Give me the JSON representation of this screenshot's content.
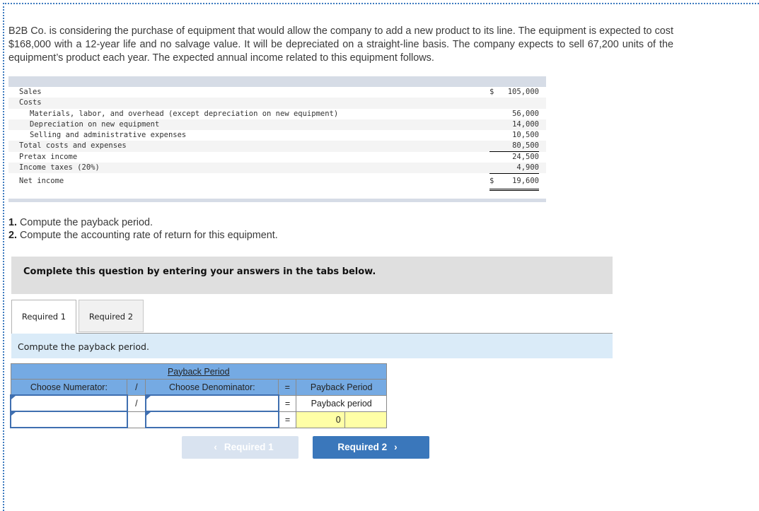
{
  "intro": "B2B Co. is considering the purchase of equipment that would allow the company to add a new product to its line. The equipment is expected to cost $168,000 with a 12-year life and no salvage value. It will be depreciated on a straight-line basis. The company expects to sell 67,200 units of the equipment’s product each year. The expected annual income related to this equipment follows.",
  "income_statement": {
    "rows": [
      {
        "label": "Sales",
        "currency": "$",
        "value": "105,000"
      },
      {
        "label": "Costs",
        "currency": "",
        "value": ""
      },
      {
        "label": "Materials, labor, and overhead (except depreciation on new equipment)",
        "currency": "",
        "value": "56,000"
      },
      {
        "label": "Depreciation on new equipment",
        "currency": "",
        "value": "14,000"
      },
      {
        "label": "Selling and administrative expenses",
        "currency": "",
        "value": "10,500"
      },
      {
        "label": "Total costs and expenses",
        "currency": "",
        "value": "80,500"
      },
      {
        "label": "Pretax income",
        "currency": "",
        "value": "24,500"
      },
      {
        "label": "Income taxes (20%)",
        "currency": "",
        "value": "4,900"
      },
      {
        "label": "Net income",
        "currency": "$",
        "value": "19,600"
      }
    ]
  },
  "requirements": [
    {
      "num": "1.",
      "text": " Compute the payback period."
    },
    {
      "num": "2.",
      "text": " Compute the accounting rate of return for this equipment."
    }
  ],
  "banner": "Complete this question by entering your answers in the tabs below.",
  "tabs": [
    {
      "label": "Required 1",
      "active": true
    },
    {
      "label": "Required 2",
      "active": false
    }
  ],
  "instruction": "Compute the payback period.",
  "payback_table": {
    "title": "Payback Period",
    "headers": {
      "numerator": "Choose Numerator:",
      "divide": "/",
      "denominator": "Choose Denominator:",
      "equals": "=",
      "result": "Payback Period"
    },
    "row1": {
      "numerator": "",
      "divide": "/",
      "denominator": "",
      "equals": "=",
      "result": "Payback period"
    },
    "row2": {
      "numerator": "",
      "divide": "",
      "denominator": "",
      "equals": "=",
      "result": "0",
      "unit": ""
    }
  },
  "nav": {
    "prev_label": "Required 1",
    "next_label": "Required 2",
    "prev_icon": "‹",
    "next_icon": "›"
  }
}
